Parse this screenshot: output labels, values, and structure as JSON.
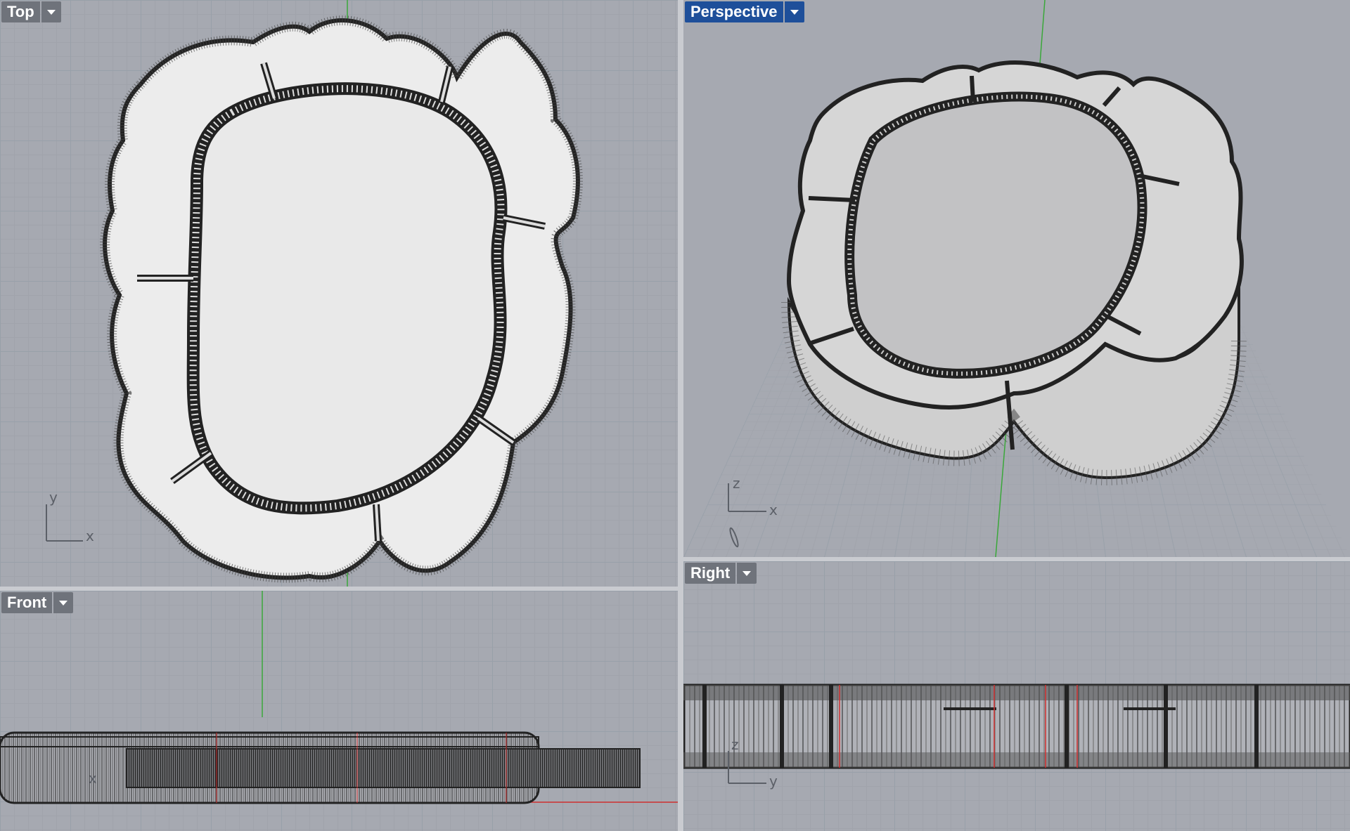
{
  "viewports": {
    "top": {
      "label": "Top",
      "axis_x": "x",
      "axis_y": "y"
    },
    "perspective": {
      "label": "Perspective",
      "axis_x": "x",
      "axis_z": "z"
    },
    "front": {
      "label": "Front",
      "axis_x": "x"
    },
    "right": {
      "label": "Right",
      "axis_z": "z",
      "axis_y": "y"
    }
  },
  "colors": {
    "viewport_bg": "#a6a9b1",
    "active_tab": "#1e4f9a",
    "inactive_tab": "#6f737b",
    "model_fill": "#ececec",
    "wire": "#222222",
    "axis_green": "#3aa83a",
    "axis_red": "#d03030",
    "axis_blue": "#2a2ad0"
  },
  "icons": {
    "dropdown": "chevron-down-icon"
  }
}
